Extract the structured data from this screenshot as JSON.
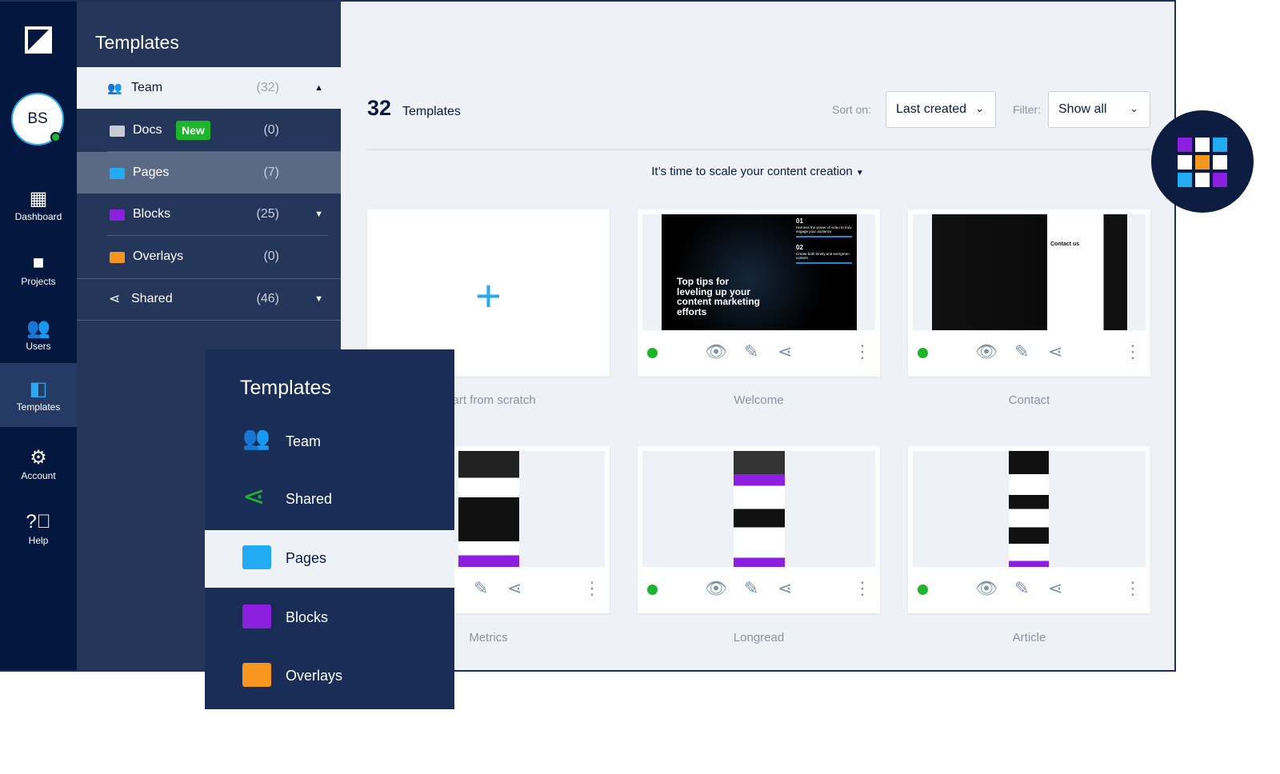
{
  "rail": {
    "avatar": "BS",
    "items": [
      {
        "label": "Dashboard",
        "icon": "dashboard-icon"
      },
      {
        "label": "Projects",
        "icon": "folder-icon"
      },
      {
        "label": "Users",
        "icon": "users-icon"
      },
      {
        "label": "Templates",
        "icon": "templates-icon",
        "active": true
      },
      {
        "label": "Account",
        "icon": "gear-icon"
      },
      {
        "label": "Help",
        "icon": "help-icon"
      }
    ]
  },
  "panel": {
    "title": "Templates",
    "items": [
      {
        "label": "Team",
        "count": "(32)",
        "icon": "users-icon",
        "color": "#2aa8f0"
      },
      {
        "label": "Docs",
        "count": "(0)",
        "badge": "New",
        "color": "#c8ccd4"
      },
      {
        "label": "Pages",
        "count": "(7)",
        "color": "#22aaf2"
      },
      {
        "label": "Blocks",
        "count": "(25)",
        "color": "#8c1fe0"
      },
      {
        "label": "Overlays",
        "count": "(0)",
        "color": "#f7961e"
      },
      {
        "label": "Shared",
        "count": "(46)",
        "icon": "share-icon"
      }
    ]
  },
  "main": {
    "count": "32",
    "count_label": "Templates",
    "sort_label": "Sort on:",
    "sort_value": "Last created",
    "filter_label": "Filter:",
    "filter_value": "Show all",
    "promo": "It’s time to scale your content creation",
    "cards": [
      {
        "label": "Start from scratch"
      },
      {
        "label": "Welcome"
      },
      {
        "label": "Contact"
      },
      {
        "label": "Metrics"
      },
      {
        "label": "Longread"
      },
      {
        "label": "Article"
      }
    ],
    "thumb_welcome": {
      "n1": "01",
      "t1": "Harness the power of video to truly engage your audience",
      "n2": "02",
      "t2": "Create both timely and evergreen content",
      "headline": "Top tips for leveling up your content marketing efforts"
    },
    "thumb_contact": {
      "heading": "Contact us"
    }
  },
  "overlay": {
    "title": "Templates",
    "items": [
      {
        "label": "Team",
        "icon": "users-icon",
        "color": "#ffffff"
      },
      {
        "label": "Shared",
        "icon": "share-icon",
        "color": "#1db52c"
      },
      {
        "label": "Pages",
        "color": "#22aaf2"
      },
      {
        "label": "Blocks",
        "color": "#8c1fe0"
      },
      {
        "label": "Overlays",
        "color": "#f7961e"
      }
    ]
  },
  "brand_grid_colors": [
    "#8c1fe0",
    "#ffffff",
    "#22aaf2",
    "#ffffff",
    "#f7961e",
    "#ffffff",
    "#22aaf2",
    "#ffffff",
    "#8c1fe0"
  ]
}
